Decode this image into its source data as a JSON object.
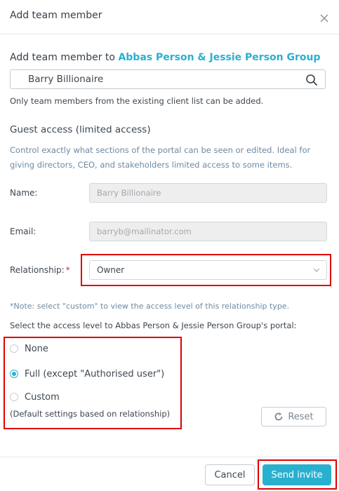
{
  "dialog": {
    "title": "Add team member",
    "subtitle_prefix": "Add team member to",
    "group_name": "Abbas Person & Jessie Person Group"
  },
  "search": {
    "value": "Barry Billionaire",
    "hint": "Only team members from the existing client list can be added."
  },
  "guest_access": {
    "title": "Guest access (limited access)",
    "description": "Control exactly what sections of the portal can be seen or edited. Ideal for giving directors, CEO, and stakeholders limited access to some items."
  },
  "form": {
    "name_label": "Name:",
    "name_value": "Barry Billionaire",
    "email_label": "Email:",
    "email_value": "barryb@mailinator.com",
    "relationship_label": "Relationship:",
    "relationship_required": "*",
    "relationship_value": "Owner"
  },
  "access": {
    "note": "*Note: select \"custom\" to view the access level of this relationship type.",
    "select_text": "Select the access level to Abbas Person & Jessie Person Group's portal:",
    "options": [
      {
        "label": "None",
        "checked": false
      },
      {
        "label": "Full (except \"Authorised user\")",
        "checked": true
      },
      {
        "label": "Custom",
        "checked": false
      }
    ],
    "default_note": "(Default settings based on relationship)",
    "reset_label": "Reset"
  },
  "footer": {
    "cancel_label": "Cancel",
    "invite_label": "Send invite"
  },
  "colors": {
    "accent": "#2ab0cf",
    "highlight": "#e00000",
    "muted_text": "#6e8aa3"
  },
  "icons": [
    "close-icon",
    "search-icon",
    "chevron-down-icon",
    "reset-icon"
  ]
}
